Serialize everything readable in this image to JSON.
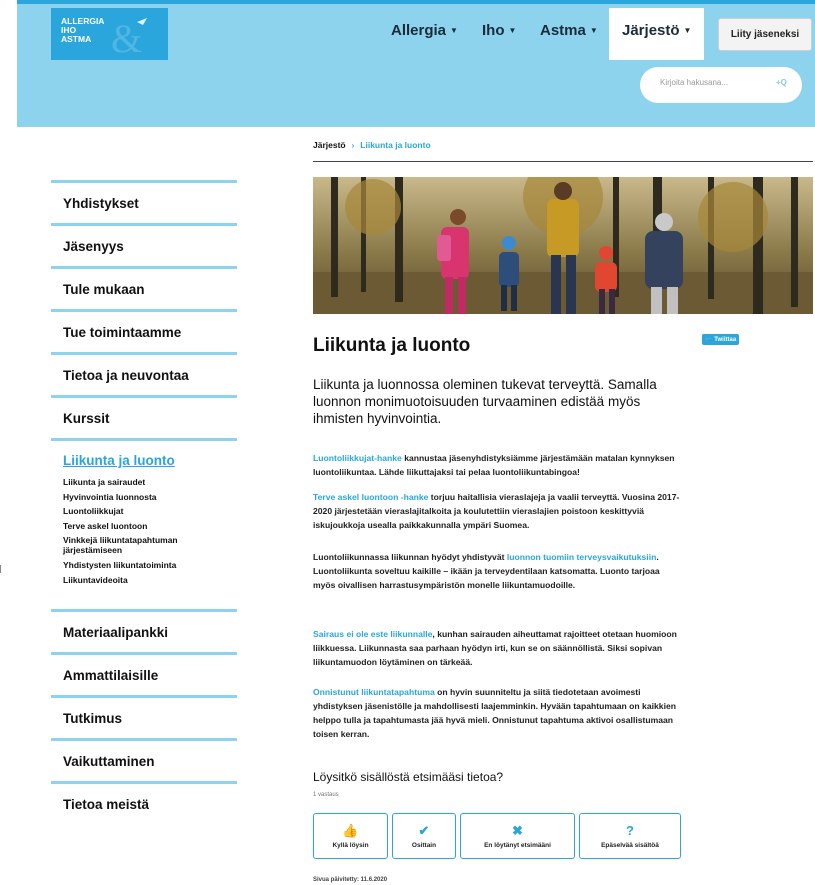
{
  "header": {
    "logo": {
      "line1": "ALLERGIA",
      "line2": "IHO",
      "line3": "ASTMA"
    },
    "nav": [
      {
        "label": "Allergia"
      },
      {
        "label": "Iho"
      },
      {
        "label": "Astma"
      },
      {
        "label": "Järjestö"
      }
    ],
    "join_label": "Liity jäseneksi",
    "search_placeholder": "Kirjoita hakusana...",
    "search_icon": "+Q"
  },
  "sidebar": {
    "items_top": [
      "Yhdistykset",
      "Jäsenyys",
      "Tule mukaan",
      "Tue toimintaamme",
      "Tietoa ja neuvontaa",
      "Kurssit"
    ],
    "active": "Liikunta ja luonto",
    "sub_items": [
      "Liikunta ja sairaudet",
      "Hyvinvointia luonnosta",
      "Luontoliikkujat",
      "Terve askel luontoon",
      "Vinkkejä liikuntatapahtuman järjestämiseen",
      "Yhdistysten liikuntatoiminta",
      "Liikuntavideoita"
    ],
    "items_bottom": [
      "Materiaalipankki",
      "Ammattilaisille",
      "Tutkimus",
      "Vaikuttaminen",
      "Tietoa meistä"
    ]
  },
  "breadcrumb": {
    "root": "Järjestö",
    "sep": "›",
    "current": "Liikunta ja luonto"
  },
  "tweet_label": "Twiittaa",
  "title": "Liikunta ja luonto",
  "lead": "Liikunta ja luonnossa oleminen tukevat terveyttä. Samalla luonnon monimuotoisuuden turvaaminen edistää myös ihmisten hyvinvointia.",
  "paragraphs": [
    {
      "link": "Luontoliikkujat-hanke",
      "text": " kannustaa jäsenyhdistyksiämme järjestämään matalan kynnyksen luontoliikuntaa. Lähde liikuttajaksi tai pelaa luontoliikuntabingoa!"
    },
    {
      "link": "Terve askel luontoon -hanke",
      "text": " torjuu haitallisia vieraslajeja ja vaalii terveyttä. Vuosina 2017-2020 järjestetään vieraslajitalkoita ja koulutettiin vieraslajien poistoon keskittyviä iskujoukkoja usealla paikkakunnalla ympäri Suomea."
    },
    {
      "pre": "Luontoliikunnassa liikunnan hyödyt yhdistyvät ",
      "link": "luonnon tuomiin terveysvaikutuksiin",
      "text": ". Luontoliikunta soveltuu kaikille – ikään ja terveydentilaan katsomatta. Luonto tarjoaa myös oivallisen harrastusympäristön monelle liikuntamuodoille."
    },
    {
      "link": "Sairaus ei ole este liikunnalle",
      "text": ", kunhan sairauden aiheuttamat rajoitteet otetaan huomioon liikkuessa. Liikunnasta saa parhaan hyödyn irti, kun se on säännöllistä. Siksi sopivan liikuntamuodon löytäminen on tärkeää."
    },
    {
      "link": "Onnistunut liikuntatapahtuma",
      "text": " on hyvin suunniteltu ja siitä tiedotetaan avoimesti yhdistyksen jäsenistölle ja mahdollisesti laajemminkin. Hyvään tapahtumaan on kaikkien helppo tulla ja tapahtumasta jää hyvä mieli. Onnistunut tapahtuma aktivoi osallistumaan toisen kerran."
    }
  ],
  "feedback": {
    "question": "Löysitkö sisällöstä etsimääsi tietoa?",
    "count": "1 vastaus",
    "buttons": [
      {
        "icon": "thumbs-up-icon",
        "label": "Kyllä löysin"
      },
      {
        "icon": "check-icon",
        "label": "Osittain"
      },
      {
        "icon": "close-icon",
        "label": "En löytänyt etsimääni"
      },
      {
        "icon": "question-icon",
        "label": "Epäselvää sisältöä"
      }
    ]
  },
  "updated": "Sivua päivitetty: 11.6.2020",
  "colors": {
    "accent": "#2aa6dc",
    "header_bg": "#8dd3ee"
  }
}
